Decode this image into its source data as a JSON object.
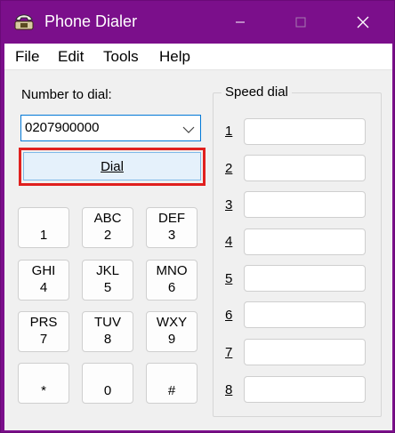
{
  "window": {
    "title": "Phone Dialer",
    "minimize_glyph": "—",
    "maximize_glyph": "☐",
    "close_glyph": "✕"
  },
  "menu": [
    "File",
    "Edit",
    "Tools",
    "Help"
  ],
  "number_label": "Number to dial:",
  "combo_value": "0207900000",
  "dial_label": "Dial",
  "keypad": [
    {
      "letters": "",
      "digit": "1"
    },
    {
      "letters": "ABC",
      "digit": "2"
    },
    {
      "letters": "DEF",
      "digit": "3"
    },
    {
      "letters": "GHI",
      "digit": "4"
    },
    {
      "letters": "JKL",
      "digit": "5"
    },
    {
      "letters": "MNO",
      "digit": "6"
    },
    {
      "letters": "PRS",
      "digit": "7"
    },
    {
      "letters": "TUV",
      "digit": "8"
    },
    {
      "letters": "WXY",
      "digit": "9"
    },
    {
      "letters": "",
      "digit": "*"
    },
    {
      "letters": "",
      "digit": "0"
    },
    {
      "letters": "",
      "digit": "#"
    }
  ],
  "speed_dial": {
    "title": "Speed dial",
    "slots": [
      "1",
      "2",
      "3",
      "4",
      "5",
      "6",
      "7",
      "8"
    ],
    "values": [
      "",
      "",
      "",
      "",
      "",
      "",
      "",
      ""
    ]
  },
  "colors": {
    "titlebar": "#7b0f8b",
    "highlight": "#e0201e",
    "dial_button": "#e5f1fb"
  }
}
